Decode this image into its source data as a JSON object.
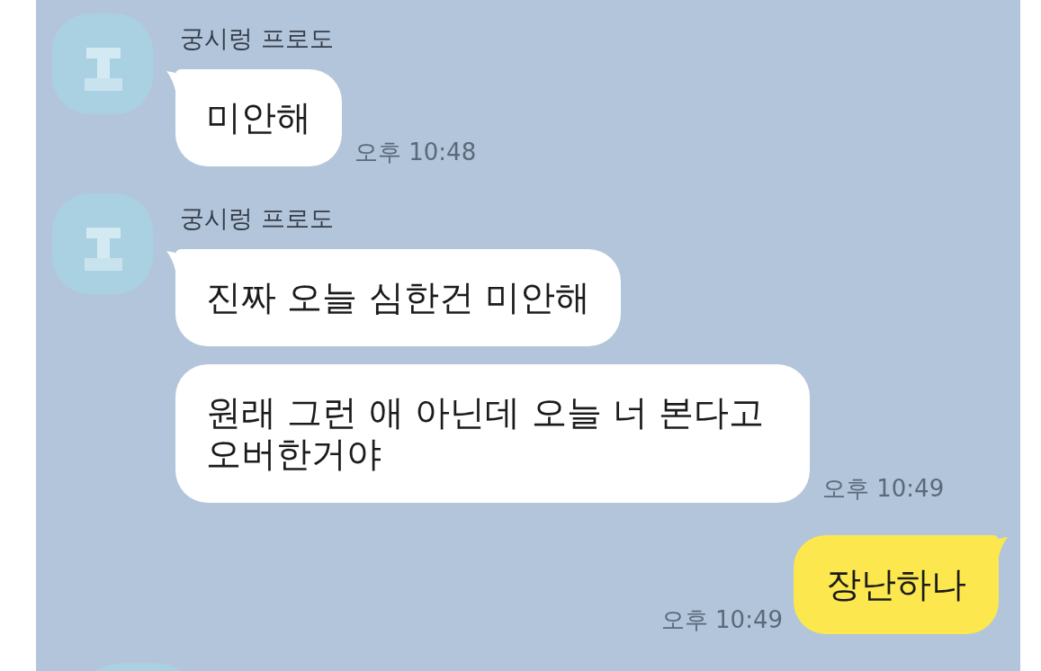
{
  "messages": [
    {
      "kind": "received",
      "sender": "궁시렁 프로도",
      "bubbles": [
        "미안해"
      ],
      "time": "오후 10:48"
    },
    {
      "kind": "received",
      "sender": "궁시렁 프로도",
      "bubbles": [
        "진짜 오늘 심한건 미안해",
        "원래 그런 애 아닌데 오늘 너 본다고 오버한거야"
      ],
      "time": "오후 10:49"
    },
    {
      "kind": "sent",
      "bubbles": [
        "장난하나"
      ],
      "time": "오후 10:49"
    },
    {
      "kind": "cut_off"
    }
  ]
}
